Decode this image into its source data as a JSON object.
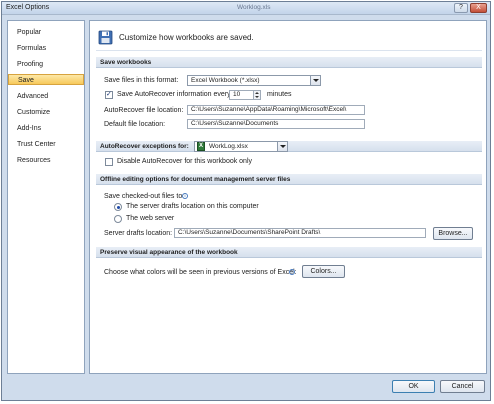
{
  "window": {
    "title": "Excel Options",
    "background_caption": "Worklog.xls",
    "help_glyph": "?",
    "close_glyph": "X"
  },
  "nav": {
    "items": [
      {
        "label": "Popular"
      },
      {
        "label": "Formulas"
      },
      {
        "label": "Proofing"
      },
      {
        "label": "Save",
        "selected": true
      },
      {
        "label": "Advanced"
      },
      {
        "label": "Customize"
      },
      {
        "label": "Add-Ins"
      },
      {
        "label": "Trust Center"
      },
      {
        "label": "Resources"
      }
    ]
  },
  "header": {
    "text": "Customize how workbooks are saved.",
    "icon": "save-disk-icon"
  },
  "save_workbooks": {
    "section_title": "Save workbooks",
    "format_label": "Save files in this format:",
    "format_value": "Excel Workbook (*.xlsx)",
    "autorecover_checkbox_label": "Save AutoRecover information every",
    "autorecover_checked": true,
    "autorecover_minutes": "10",
    "minutes_label": "minutes",
    "autorecover_location_label": "AutoRecover file location:",
    "autorecover_location_value": "C:\\Users\\Suzanne\\AppData\\Roaming\\Microsoft\\Excel\\",
    "default_location_label": "Default file location:",
    "default_location_value": "C:\\Users\\Suzanne\\Documents"
  },
  "autorecover_exceptions": {
    "section_title": "AutoRecover exceptions for:",
    "workbook_value": "WorkLog.xlsx",
    "disable_label": "Disable AutoRecover for this workbook only",
    "disable_checked": false
  },
  "offline": {
    "section_title": "Offline editing options for document management server files",
    "save_to_label": "Save checked-out files to:",
    "option_server_drafts": "The server drafts location on this computer",
    "option_web_server": "The web server",
    "selected_option": "server_drafts",
    "drafts_location_label": "Server drafts location:",
    "drafts_location_value": "C:\\Users\\Suzanne\\Documents\\SharePoint Drafts\\",
    "browse_label": "Browse..."
  },
  "visual": {
    "section_title": "Preserve visual appearance of the workbook",
    "colors_prompt": "Choose what colors will be seen in previous versions of Excel:",
    "colors_button": "Colors..."
  },
  "footer": {
    "ok_label": "OK",
    "cancel_label": "Cancel"
  },
  "colors": {
    "selected_nav": "#f7c95b",
    "section_band": "#d6e0ed",
    "window_frame": "#cfdcec"
  }
}
